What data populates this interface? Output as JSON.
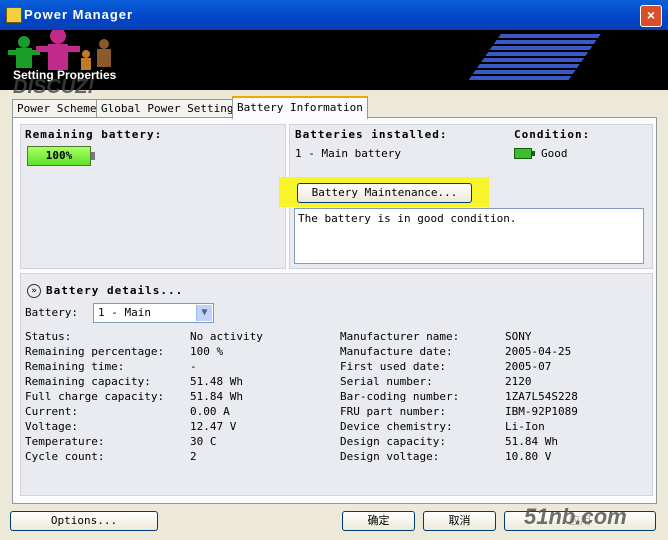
{
  "window": {
    "title": "Power Manager"
  },
  "banner": {
    "title": "Setting Properties",
    "watermark": "DISCUZ!"
  },
  "tabs": [
    {
      "label": "Power Scheme"
    },
    {
      "label": "Global Power Settings"
    },
    {
      "label": "Battery Information"
    }
  ],
  "remaining": {
    "label": "Remaining battery:",
    "percent": "100%",
    "level": 1.0
  },
  "installed": {
    "label": "Batteries installed:",
    "value": "1 - Main battery"
  },
  "condition": {
    "label": "Condition:",
    "value": "Good"
  },
  "maintenance_button": "Battery Maintenance...",
  "message": "The battery is in good condition.",
  "details": {
    "title": "Battery details...",
    "battery_label": "Battery:",
    "battery_select": "1 - Main",
    "left": [
      {
        "label": "Status:",
        "value": "No activity"
      },
      {
        "label": "Remaining percentage:",
        "value": "100 %"
      },
      {
        "label": "Remaining time:",
        "value": "-"
      },
      {
        "label": "Remaining capacity:",
        "value": "51.48 Wh"
      },
      {
        "label": "Full charge capacity:",
        "value": "51.84 Wh"
      },
      {
        "label": "Current:",
        "value": "0.00 A"
      },
      {
        "label": "Voltage:",
        "value": "12.47 V"
      },
      {
        "label": "Temperature:",
        "value": "30 C"
      },
      {
        "label": "Cycle count:",
        "value": "2"
      }
    ],
    "right": [
      {
        "label": "Manufacturer name:",
        "value": "SONY"
      },
      {
        "label": "Manufacture date:",
        "value": "2005-04-25"
      },
      {
        "label": "First used date:",
        "value": "2005-07"
      },
      {
        "label": "Serial number:",
        "value": "2120"
      },
      {
        "label": "Bar-coding number:",
        "value": "1ZA7L54S228"
      },
      {
        "label": "FRU part number:",
        "value": "IBM-92P1089"
      },
      {
        "label": "Device chemistry:",
        "value": "Li-Ion"
      },
      {
        "label": "Design capacity:",
        "value": "51.84 Wh"
      },
      {
        "label": "Design voltage:",
        "value": "10.80 V"
      }
    ]
  },
  "footer": {
    "options": "Options...",
    "ok": "确定",
    "cancel": "取消",
    "apply": "应用"
  },
  "logo_text": "51nb.com",
  "colors": {
    "titlebar": "#0046c8",
    "tab_active_border": "#f2a600",
    "highlight": "#f7f42a",
    "battery_fill": "#5ee12a"
  }
}
